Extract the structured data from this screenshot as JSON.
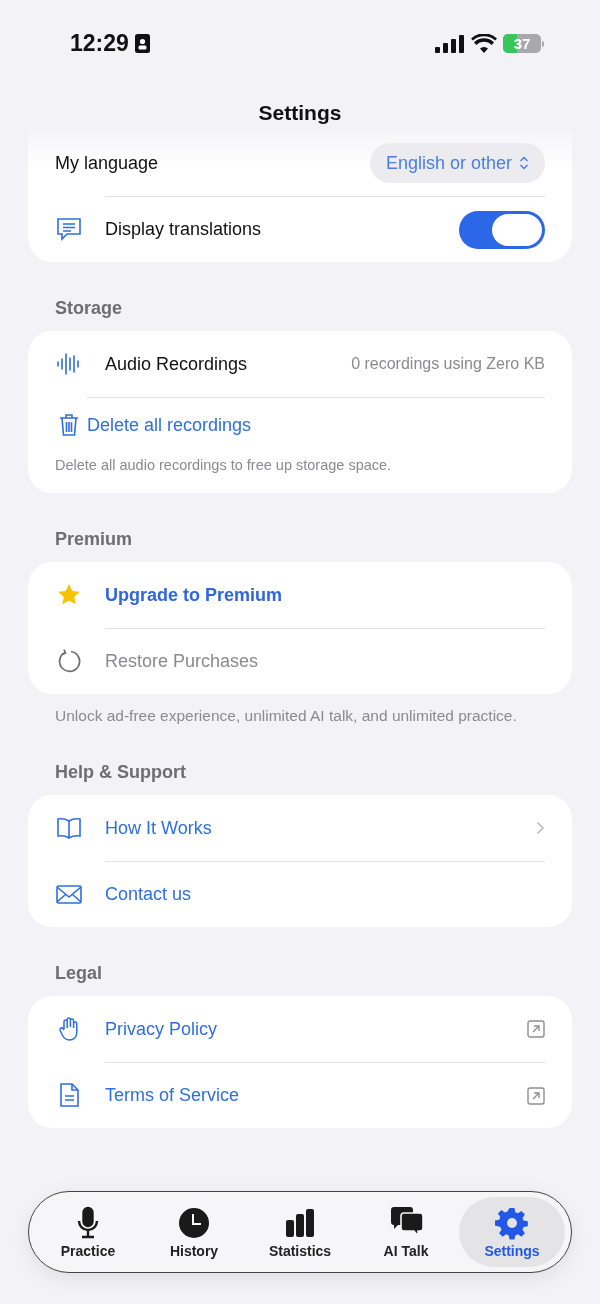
{
  "status_bar": {
    "time": "12:29",
    "battery": "37"
  },
  "title": "Settings",
  "sections": [
    {
      "rows": [
        {
          "kind": "picker",
          "label": "My language",
          "value": "English or other",
          "disabled": false
        },
        {
          "kind": "toggle",
          "label": "Display translations",
          "on": true,
          "disabled": false
        }
      ]
    },
    {
      "header": "Storage",
      "rows": [
        {
          "kind": "info",
          "label": "Audio Recordings",
          "value": "0 recordings using Zero KB",
          "disabled": false
        },
        {
          "kind": "action",
          "label": "Delete all recordings",
          "disabled": false
        }
      ],
      "card_note": "Delete all audio recordings to free up storage space."
    },
    {
      "header": "Premium",
      "rows": [
        {
          "kind": "featured",
          "label": "Upgrade to Premium",
          "disabled": false
        },
        {
          "kind": "link",
          "label": "Restore Purchases",
          "disabled": true
        }
      ],
      "footer": "Unlock ad-free experience, unlimited AI talk, and unlimited practice."
    },
    {
      "header": "Help & Support",
      "rows": [
        {
          "kind": "chevron",
          "label": "How It Works",
          "disabled": false
        },
        {
          "kind": "link",
          "label": "Contact us",
          "disabled": false
        }
      ]
    },
    {
      "header": "Legal",
      "rows": [
        {
          "kind": "external",
          "label": "Privacy Policy",
          "disabled": false
        },
        {
          "kind": "external",
          "label": "Terms of Service",
          "disabled": false
        }
      ]
    }
  ],
  "tabs": [
    {
      "label": "Practice",
      "selected": false
    },
    {
      "label": "History",
      "selected": false
    },
    {
      "label": "Statistics",
      "selected": false
    },
    {
      "label": "AI Talk",
      "selected": false
    },
    {
      "label": "Settings",
      "selected": true
    }
  ]
}
